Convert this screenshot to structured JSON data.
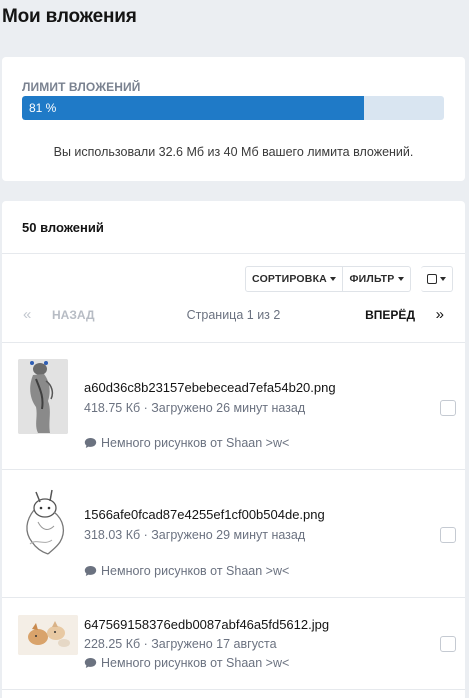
{
  "page": {
    "title": "Мои вложения"
  },
  "limit": {
    "label": "ЛИМИТ ВЛОЖЕНИЙ",
    "percent": 81,
    "percent_text": "81 %",
    "description": "Вы использовали 32.6 Мб из 40 Мб вашего лимита вложений.",
    "bar_color": "#1f7ac7",
    "track_color": "#d9e5f1"
  },
  "list": {
    "count_label": "50 вложений",
    "toolbar": {
      "sort_label": "СОРТИРОВКА",
      "filter_label": "ФИЛЬТР",
      "select_icon": "checkbox-square-icon"
    },
    "pager": {
      "first": "«",
      "prev": "НАЗАД",
      "info": "Страница 1 из 2",
      "next": "ВПЕРЁД",
      "last": "»"
    },
    "items": [
      {
        "name": "a60d36c8b23157ebebecead7efa54b20.png",
        "meta": "418.75 Кб · Загружено 26 минут назад",
        "source": "Немного рисунков от Shaan >w<"
      },
      {
        "name": "1566afe0fcad87e4255ef1cf00b504de.png",
        "meta": "318.03 Кб · Загружено 29 минут назад",
        "source": "Немного рисунков от Shaan >w<"
      },
      {
        "name": "647569158376edb0087abf46a5fd5612.jpg",
        "meta": "228.25 Кб · Загружено 17 августа",
        "source": "Немного рисунков от Shaan >w<"
      }
    ]
  }
}
